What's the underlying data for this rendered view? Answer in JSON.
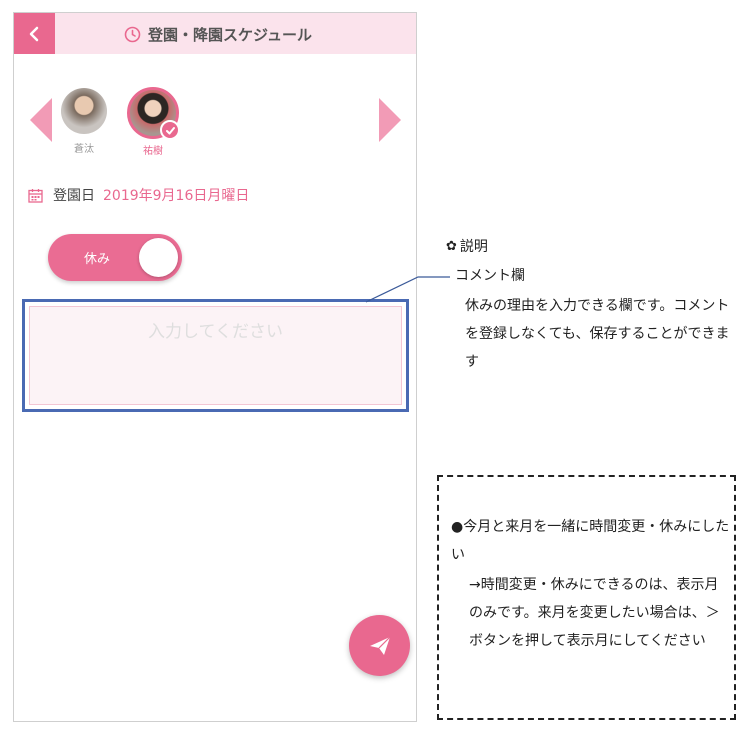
{
  "header": {
    "title": "登園・降園スケジュール",
    "back_icon": "chevron-left-icon",
    "title_icon": "clock-icon"
  },
  "children": [
    {
      "name": "蒼汰",
      "selected": false
    },
    {
      "name": "祐樹",
      "selected": true
    }
  ],
  "date": {
    "label": "登園日",
    "value": "2019年9月16日月曜日"
  },
  "absence_toggle": {
    "label": "休み",
    "on": true
  },
  "comment": {
    "placeholder": "入力してください",
    "value": ""
  },
  "send_button": {
    "icon": "send-icon"
  },
  "annotation": {
    "heading": "説明",
    "heading_icon": "flower-icon",
    "title": "コメント欄",
    "body": "休みの理由を入力できる欄です。コメントを登録しなくても、保存することができます"
  },
  "faq": {
    "question": "●今月と来月を一緒に時間変更・休みにしたい",
    "answer": "→時間変更・休みにできるのは、表示月のみです。来月を変更したい場合は、＞ボタンを押して表示月にしてください"
  },
  "colors": {
    "accent": "#e9688f",
    "header_bg": "#fbe3ec",
    "arrow": "#f29bb6",
    "highlight_border": "#4a6ab3"
  }
}
